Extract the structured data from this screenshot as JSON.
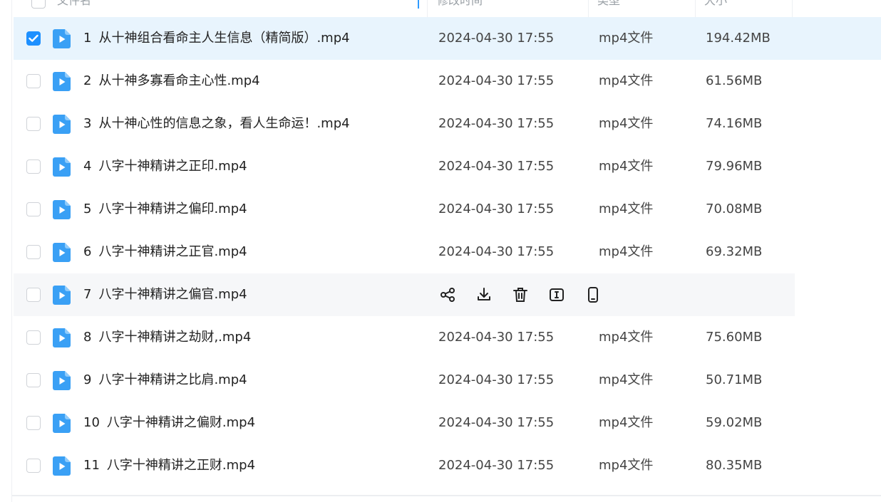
{
  "header": {
    "col_name": "文件名",
    "col_modified": "修改时间",
    "col_type": "类型",
    "col_size": "大小"
  },
  "colors": {
    "accent": "#1e90ff",
    "selected_row": "#e8f4fd",
    "hover_row": "#f6f7f9",
    "file_icon": "#3aa0f5"
  },
  "files": [
    {
      "num": "1",
      "name": "从十神组合看命主人生信息（精简版）.mp4",
      "modified": "2024-04-30 17:55",
      "type": "mp4文件",
      "size": "194.42MB",
      "checked": true
    },
    {
      "num": "2",
      "name": "从十神多寡看命主心性.mp4",
      "modified": "2024-04-30 17:55",
      "type": "mp4文件",
      "size": "61.56MB"
    },
    {
      "num": "3",
      "name": "从十神心性的信息之象，看人生命运！.mp4",
      "modified": "2024-04-30 17:55",
      "type": "mp4文件",
      "size": "74.16MB"
    },
    {
      "num": "4",
      "name": "八字十神精讲之正印.mp4",
      "modified": "2024-04-30 17:55",
      "type": "mp4文件",
      "size": "79.96MB"
    },
    {
      "num": "5",
      "name": "八字十神精讲之偏印.mp4",
      "modified": "2024-04-30 17:55",
      "type": "mp4文件",
      "size": "70.08MB"
    },
    {
      "num": "6",
      "name": "八字十神精讲之正官.mp4",
      "modified": "2024-04-30 17:55",
      "type": "mp4文件",
      "size": "69.32MB"
    },
    {
      "num": "7",
      "name": "八字十神精讲之偏官.mp4",
      "hovered": true
    },
    {
      "num": "8",
      "name": "八字十神精讲之劫财,.mp4",
      "modified": "2024-04-30 17:55",
      "type": "mp4文件",
      "size": "75.60MB"
    },
    {
      "num": "9",
      "name": "八字十神精讲之比肩.mp4",
      "modified": "2024-04-30 17:55",
      "type": "mp4文件",
      "size": "50.71MB"
    },
    {
      "num": "10",
      "name": "八字十神精讲之偏财.mp4",
      "modified": "2024-04-30 17:55",
      "type": "mp4文件",
      "size": "59.02MB"
    },
    {
      "num": "11",
      "name": "八字十神精讲之正财.mp4",
      "modified": "2024-04-30 17:55",
      "type": "mp4文件",
      "size": "80.35MB"
    }
  ],
  "hover_actions": [
    "share-icon",
    "download-icon",
    "delete-icon",
    "rename-icon",
    "send-to-phone-icon"
  ]
}
